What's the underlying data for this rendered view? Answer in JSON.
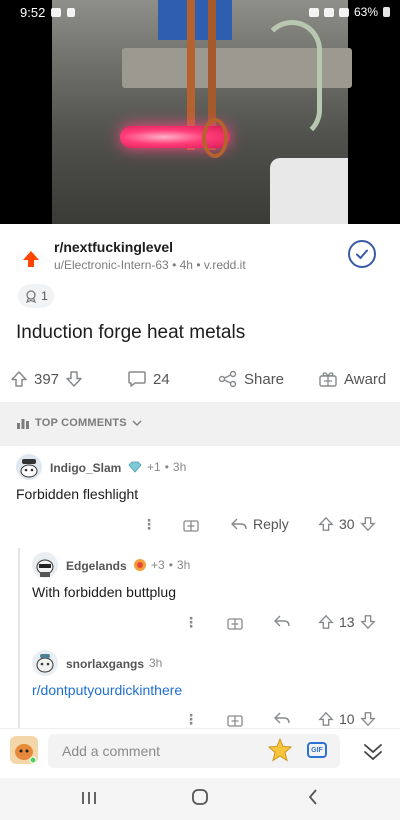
{
  "status_bar": {
    "time": "9:52",
    "battery": "63%"
  },
  "post": {
    "subreddit": "r/nextfuckinglevel",
    "author": "u/Electronic-Intern-63",
    "age": "4h",
    "domain": "v.redd.it",
    "award_count": "1",
    "title": "Induction forge heat metals",
    "votes": "397",
    "comments": "24",
    "share_label": "Share",
    "award_label": "Award"
  },
  "sort": {
    "label": "TOP COMMENTS"
  },
  "comments": [
    {
      "username": "Indigo_Slam",
      "award_count": "+1",
      "age": "3h",
      "text": "Forbidden fleshlight",
      "reply_label": "Reply",
      "score": "30"
    },
    {
      "username": "Edgelands",
      "award_count": "+3",
      "age": "3h",
      "text": "With forbidden buttplug",
      "score": "13"
    },
    {
      "username": "snorlaxgangs",
      "age": "3h",
      "link": "r/dontputyourdickinthere",
      "score": "10"
    }
  ],
  "composer": {
    "placeholder": "Add a comment",
    "gif_label": "GIF"
  },
  "colors": {
    "upvote_orange": "#ff4500",
    "link_blue": "#1f6fd1",
    "check_blue": "#3b5aa8"
  }
}
